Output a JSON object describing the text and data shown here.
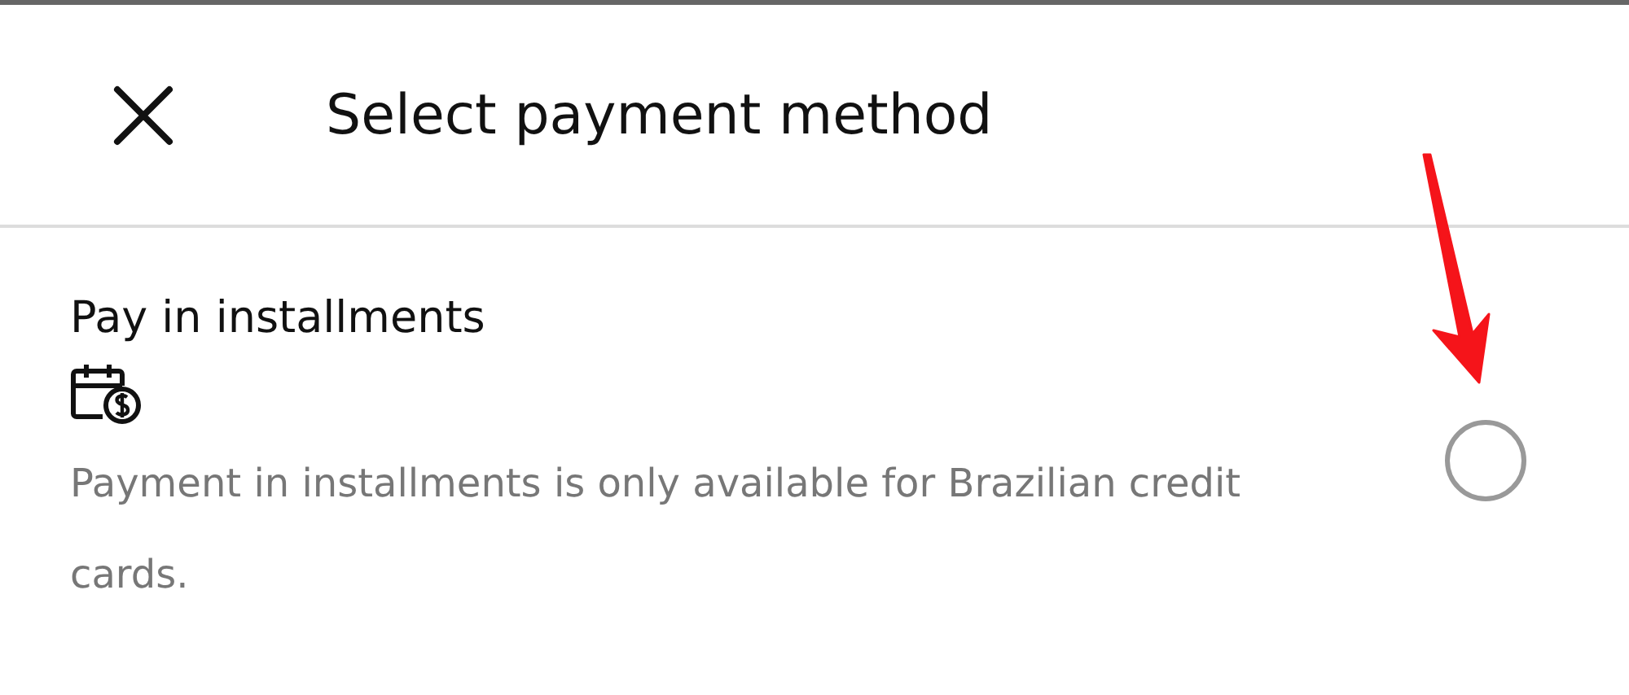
{
  "header": {
    "title": "Select payment method"
  },
  "options": [
    {
      "title": "Pay in installments",
      "description": "Payment in installments is only available for Brazilian credit cards.",
      "selected": false
    }
  ]
}
